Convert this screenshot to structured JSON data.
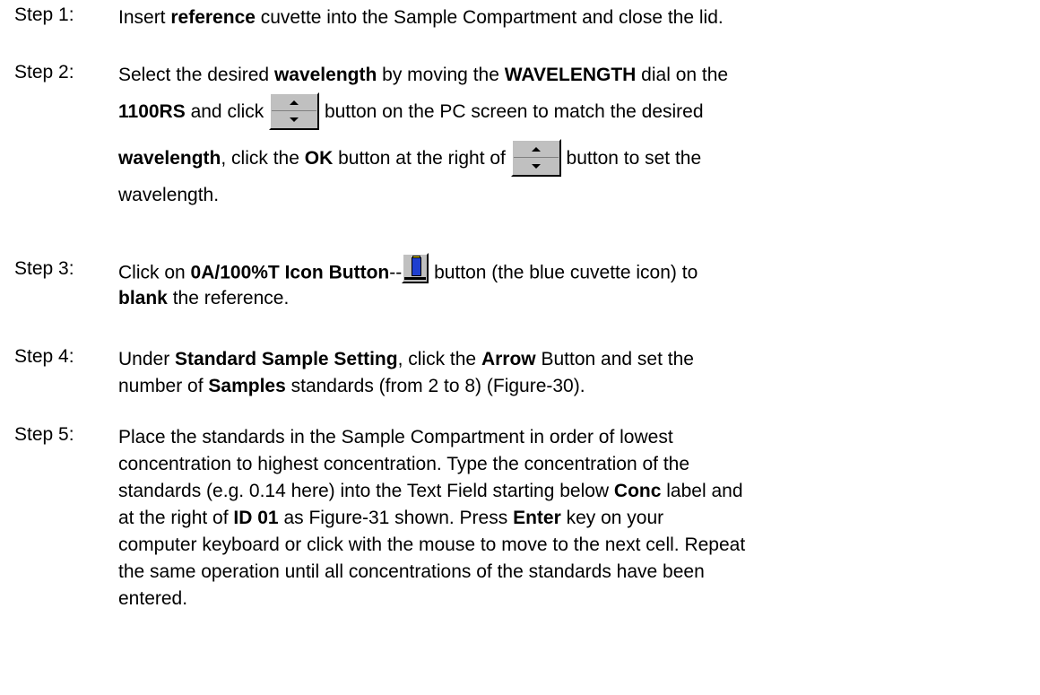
{
  "steps": [
    {
      "label": "Step 1:",
      "lines": [
        [
          "Insert ",
          {
            "b": "reference"
          },
          " cuvette into the Sample Compartment and close the lid."
        ]
      ]
    },
    {
      "label": "Step 2:",
      "lines": [
        [
          "Select the desired ",
          {
            "b": "wavelength"
          },
          " by moving the ",
          {
            "b": "WAVELENGTH"
          },
          " dial on the"
        ],
        [
          {
            "b": "1100RS"
          },
          " and click ",
          {
            "icon": "spin"
          },
          " button on the PC screen to match the desired"
        ],
        [
          {
            "b": "wavelength"
          },
          ", click the ",
          {
            "b": "OK"
          },
          " button at the right of ",
          {
            "icon": "spin"
          },
          " button to set the"
        ],
        [
          "wavelength."
        ]
      ]
    },
    {
      "label": "Step 3:",
      "lines": [
        [
          "Click on ",
          {
            "b": "0A/100%T Icon Button"
          },
          "--",
          {
            "icon": "cuvette"
          },
          " button (the blue cuvette icon) to"
        ],
        [
          {
            "b": "blank"
          },
          " the reference."
        ]
      ]
    },
    {
      "label": "Step 4:",
      "lines": [
        [
          "Under ",
          {
            "b": "Standard Sample Setting"
          },
          ", click the ",
          {
            "b": "Arrow"
          },
          " Button and set the"
        ],
        [
          "number of ",
          {
            "b": "Samples"
          },
          " standards (from 2 to 8) (Figure-30)."
        ]
      ]
    },
    {
      "label": "Step 5:",
      "lines": [
        [
          "Place the standards in the Sample Compartment in order of lowest"
        ],
        [
          "concentration to highest concentration.  Type the concentration of the"
        ],
        [
          "standards (e.g. 0.14 here) into the Text Field starting below ",
          {
            "b": "Conc"
          },
          " label and"
        ],
        [
          "at the right of ",
          {
            "b": "ID 01"
          },
          " as Figure-31 shown.  Press ",
          {
            "b": "Enter"
          },
          " key on your"
        ],
        [
          "computer keyboard or click with the mouse to move to the next cell.  Repeat"
        ],
        [
          "the same operation until all concentrations of the standards have been"
        ],
        [
          "entered."
        ]
      ]
    }
  ]
}
